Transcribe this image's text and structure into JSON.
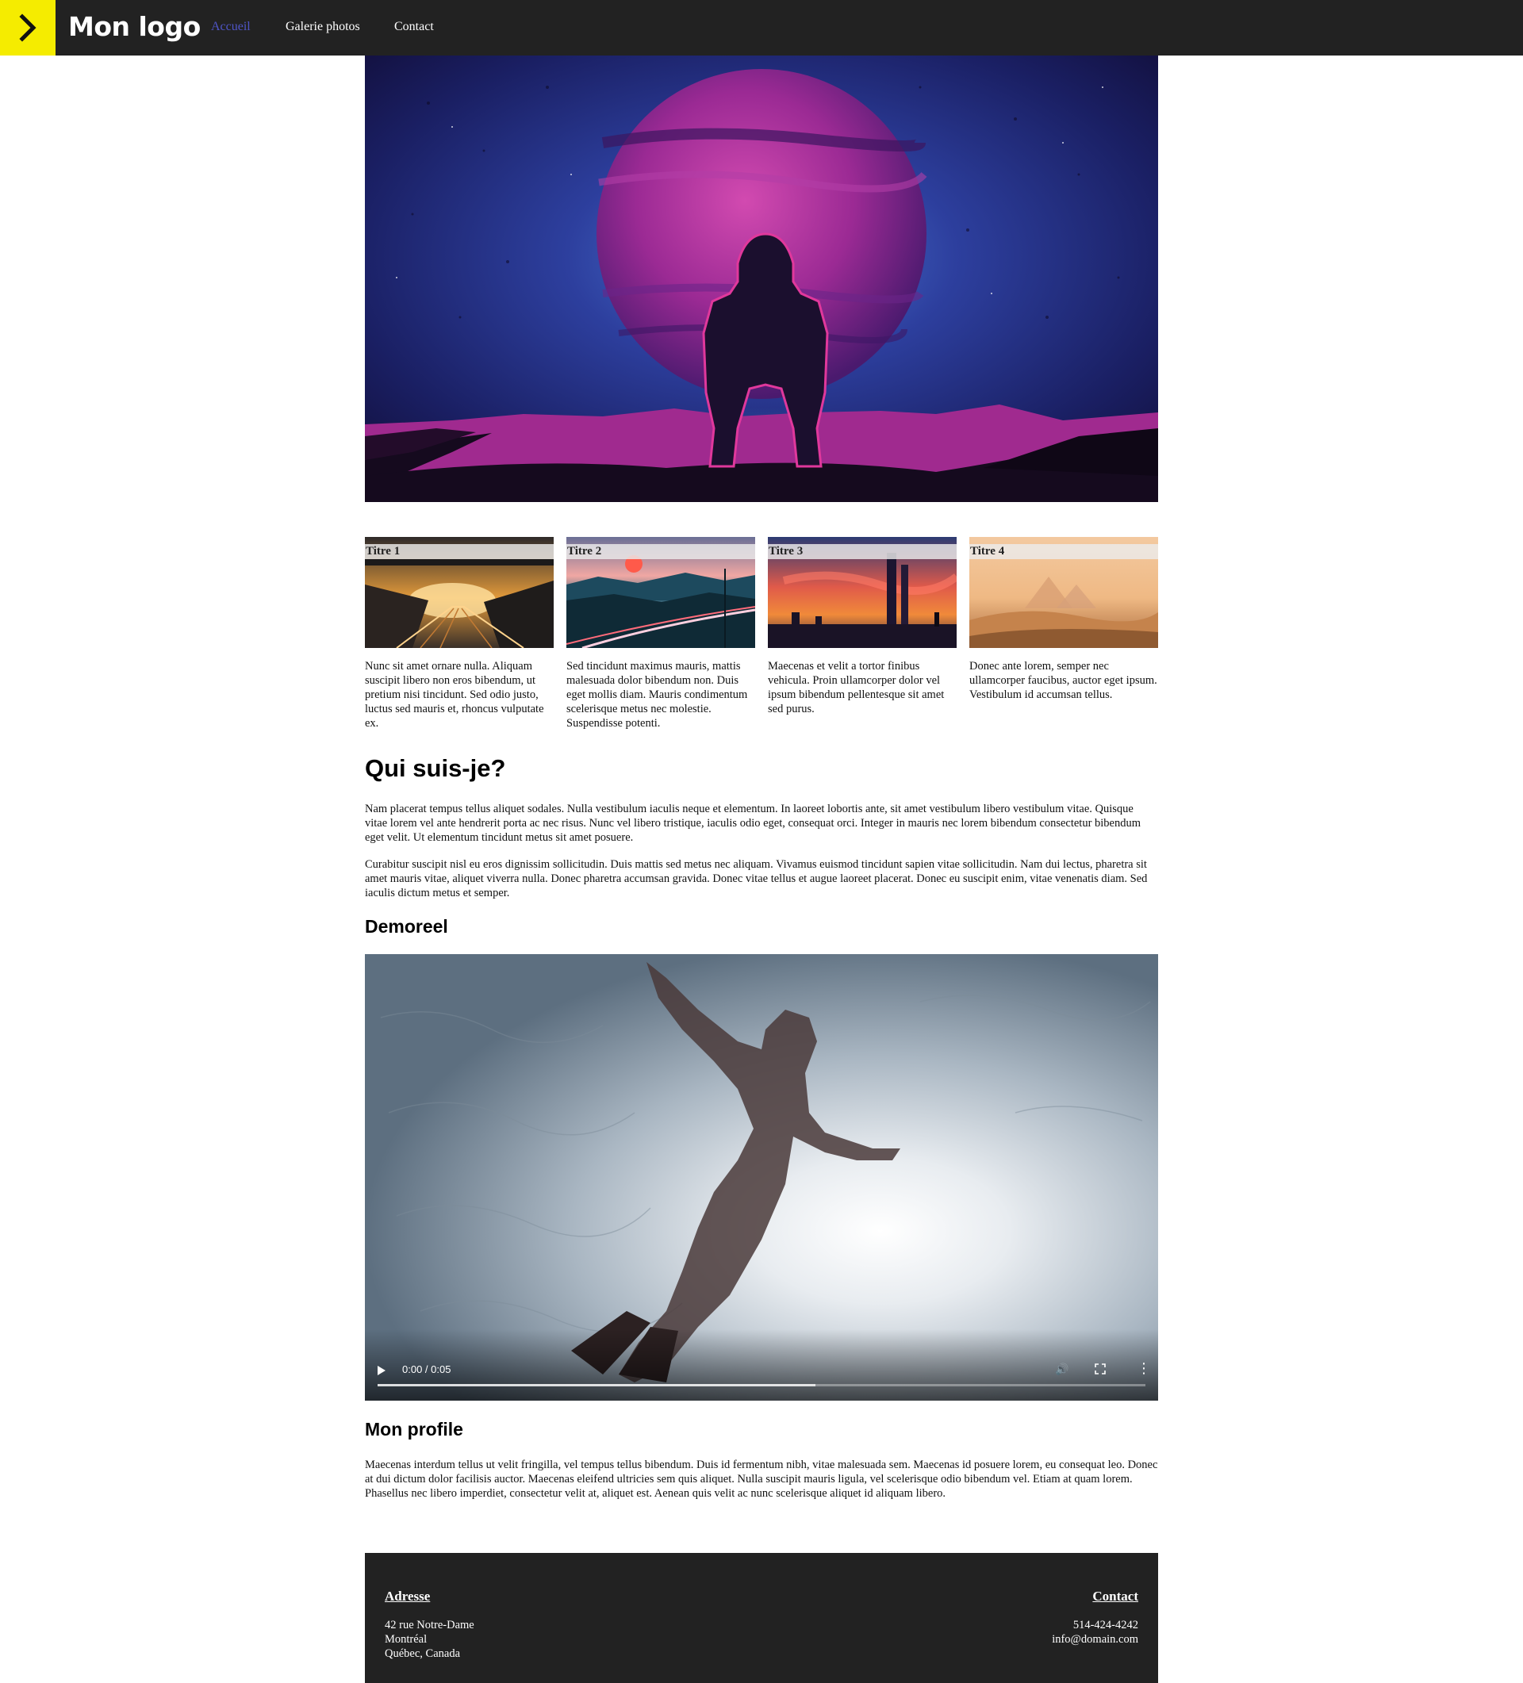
{
  "nav": {
    "logo_text": "Mon logo",
    "links": [
      {
        "label": "Accueil",
        "active": true
      },
      {
        "label": "Galerie photos",
        "active": false
      },
      {
        "label": "Contact",
        "active": false
      }
    ],
    "accent_color": "#f5ec00",
    "active_color": "#4f55c7",
    "bar_color": "#222222"
  },
  "cards": [
    {
      "title": "Titre 1",
      "text": "Nunc sit amet ornare nulla. Aliquam suscipit libero non eros bibendum, ut pretium nisi tincidunt. Sed odio justo, luctus sed mauris et, rhoncus vulputate ex."
    },
    {
      "title": "Titre 2",
      "text": "Sed tincidunt maximus mauris, mattis malesuada dolor bibendum non. Duis eget mollis diam. Mauris condimentum scelerisque metus nec molestie. Suspendisse potenti."
    },
    {
      "title": "Titre 3",
      "text": "Maecenas et velit a tortor finibus vehicula. Proin ullamcorper dolor vel ipsum bibendum pellentesque sit amet sed purus."
    },
    {
      "title": "Titre 4",
      "text": "Donec ante lorem, semper nec ullamcorper faucibus, auctor eget ipsum. Vestibulum id accumsan tellus."
    }
  ],
  "about": {
    "heading": "Qui suis-je?",
    "paragraphs": [
      "Nam placerat tempus tellus aliquet sodales. Nulla vestibulum iaculis neque et elementum. In laoreet lobortis ante, sit amet vestibulum libero vestibulum vitae. Quisque vitae lorem vel ante hendrerit porta ac nec risus. Nunc vel libero tristique, iaculis odio eget, consequat orci. Integer in mauris nec lorem bibendum consectetur bibendum eget velit. Ut elementum tincidunt metus sit amet posuere.",
      "Curabitur suscipit nisl eu eros dignissim sollicitudin. Duis mattis sed metus nec aliquam. Vivamus euismod tincidunt sapien vitae sollicitudin. Nam dui lectus, pharetra sit amet mauris vitae, aliquet viverra nulla. Donec pharetra accumsan gravida. Donec vitae tellus et augue laoreet placerat. Donec eu suscipit enim, vitae venenatis diam. Sed iaculis dictum metus et semper."
    ]
  },
  "demoreel": {
    "heading": "Demoreel",
    "video": {
      "time": "0:00 / 0:05",
      "buffered_fraction": 0.57
    }
  },
  "profile": {
    "heading": "Mon profile",
    "text": "Maecenas interdum tellus ut velit fringilla, vel tempus tellus bibendum. Duis id fermentum nibh, vitae malesuada sem. Maecenas id posuere lorem, eu consequat leo. Donec at dui dictum dolor facilisis auctor. Maecenas eleifend ultricies sem quis aliquet. Nulla suscipit mauris ligula, vel scelerisque odio bibendum vel. Etiam at quam lorem. Phasellus nec libero imperdiet, consectetur velit at, aliquet est. Aenean quis velit ac nunc scelerisque aliquet id aliquam libero."
  },
  "footer": {
    "address": {
      "heading": "Adresse",
      "lines": [
        "42 rue Notre-Dame",
        "Montréal",
        "Québec, Canada"
      ]
    },
    "contact": {
      "heading": "Contact",
      "lines": [
        "514-424-4242",
        "info@domain.com"
      ]
    }
  }
}
